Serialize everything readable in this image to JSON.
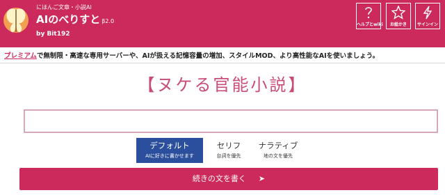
{
  "header": {
    "tagline": "にほんご文章・小説AI",
    "app_name": "AIのべりすと",
    "version": "β2.0",
    "byline": "by Bit192",
    "buttons": [
      {
        "label": "ヘルプとwiki",
        "icon": "question-icon"
      },
      {
        "label": "お絵かき",
        "icon": "star-icon"
      },
      {
        "label": "サインイン",
        "icon": "lightning-icon"
      }
    ]
  },
  "notice": {
    "link_text": "プレミアム",
    "text": "で無制限・高速な専用サーバーや、AIが扱える記憶容量の増加、スタイルMOD、より高性能なAIを使いましょう。"
  },
  "site_title": "【ヌケる官能小説】",
  "input": {
    "value": "",
    "placeholder": ""
  },
  "modes": [
    {
      "title": "デフォルト",
      "subtitle": "AIに好きに書かせます",
      "active": true
    },
    {
      "title": "セリフ",
      "subtitle": "台詞を優先",
      "active": false
    },
    {
      "title": "ナラティブ",
      "subtitle": "地の文を優先",
      "active": false
    }
  ],
  "submit": {
    "label": "続きの文を書く",
    "arrow": "➤"
  },
  "colors": {
    "brand": "#cc2a5c",
    "active_mode": "#2b4f9c",
    "title_text": "#c94c78",
    "input_border": "#d8a7b9"
  }
}
